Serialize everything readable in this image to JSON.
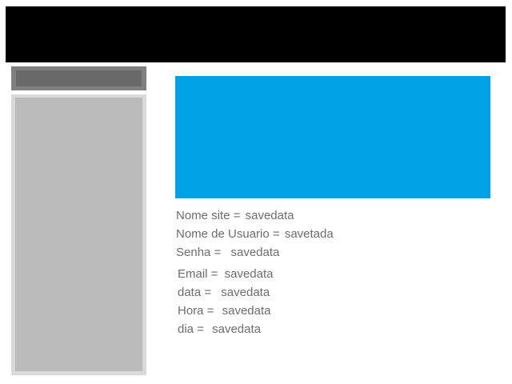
{
  "colors": {
    "header": "#000000",
    "banner": "#00a2e6",
    "sidebar_top": "#808080",
    "sidebar_panel": "#bbbbbb",
    "text": "#6d6d6d"
  },
  "fields": [
    {
      "label": "Nome site =",
      "value": "savedata"
    },
    {
      "label": "Nome de Usuario =",
      "value": "savetada"
    },
    {
      "label": "Senha =",
      "value": "savedata"
    },
    {
      "label": "Email =",
      "value": "savedata"
    },
    {
      "label": "data =",
      "value": "savedata"
    },
    {
      "label": "Hora =",
      "value": "savedata"
    },
    {
      "label": "dia =",
      "value": "savedata"
    }
  ]
}
